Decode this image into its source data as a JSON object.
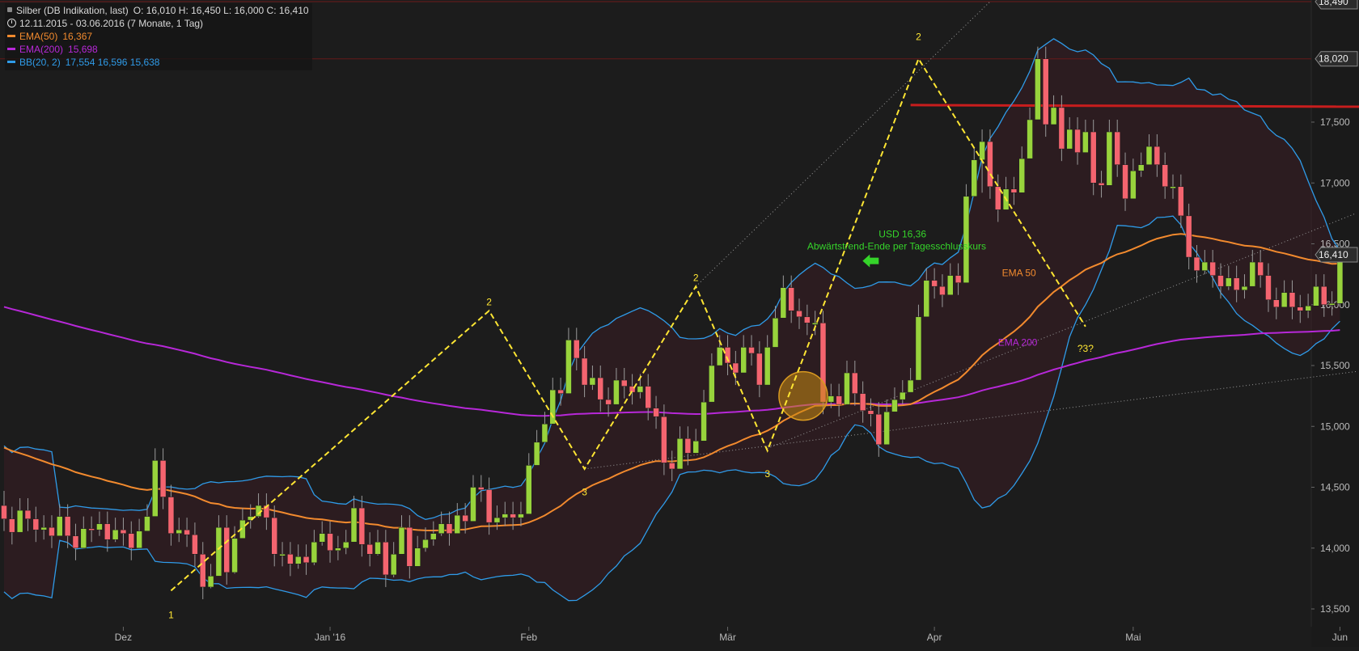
{
  "legend": {
    "title": "Silber (DB Indikation, last)",
    "ohlc": "O: 16,010  H: 16,450  L: 16,000  C: 16,410",
    "range": "12.11.2015 - 03.06.2016 (7 Monate, 1 Tag)",
    "indicators": [
      {
        "label": "EMA(50)",
        "values": "16,367",
        "color": "#f28a2e"
      },
      {
        "label": "EMA(200)",
        "values": "15,698",
        "color": "#b728d8"
      },
      {
        "label": "BB(20, 2)",
        "values": "17,554  16,596  15,638",
        "color": "#2f9be8"
      }
    ]
  },
  "colors": {
    "background": "#1c1c1c",
    "up": "#98d33c",
    "down": "#f4646f",
    "wick": "#9a9a9a",
    "ema50": "#f28a2e",
    "ema200": "#b728d8",
    "bb": "#2f9be8",
    "pattern": "#ffe633",
    "resistance": "#c81d1d",
    "annotation_green": "#35d42a",
    "axis_text": "#bbbbbb"
  },
  "chart_data": {
    "type": "candlestick",
    "instrument": "Silber (DB Indikation, last)",
    "ylim": [
      13.4,
      18.5
    ],
    "y_ticks": [
      {
        "v": 13.5,
        "label": "13,500"
      },
      {
        "v": 14.0,
        "label": "14,000"
      },
      {
        "v": 14.5,
        "label": "14,500"
      },
      {
        "v": 15.0,
        "label": "15,000"
      },
      {
        "v": 15.5,
        "label": "15,500"
      },
      {
        "v": 16.0,
        "label": "16,000"
      },
      {
        "v": 16.5,
        "label": "16,500"
      },
      {
        "v": 17.0,
        "label": "17,000"
      },
      {
        "v": 17.5,
        "label": "17,500"
      }
    ],
    "y_tags": [
      {
        "v": 18.49,
        "label": "18,490"
      },
      {
        "v": 18.02,
        "label": "18,020"
      },
      {
        "v": 16.41,
        "label": "16,410"
      }
    ],
    "x_ticks": [
      {
        "i": 15,
        "label": "Dez"
      },
      {
        "i": 41,
        "label": "Jan '16"
      },
      {
        "i": 66,
        "label": "Feb"
      },
      {
        "i": 91,
        "label": "Mär"
      },
      {
        "i": 117,
        "label": "Apr"
      },
      {
        "i": 142,
        "label": "Mai"
      },
      {
        "i": 168,
        "label": "Jun"
      }
    ],
    "candles": [
      [
        14.35,
        14.24,
        14.47,
        14.14
      ],
      [
        14.24,
        14.13,
        14.34,
        14.03
      ],
      [
        14.13,
        14.31,
        14.41,
        14.21
      ],
      [
        14.31,
        14.24,
        14.41,
        14.14
      ],
      [
        14.24,
        14.15,
        14.34,
        14.05
      ],
      [
        14.15,
        14.17,
        14.27,
        14.07
      ],
      [
        14.17,
        14.1,
        14.27,
        14.0
      ],
      [
        14.1,
        14.26,
        14.36,
        14.16
      ],
      [
        14.26,
        14.1,
        14.36,
        14.0
      ],
      [
        14.1,
        14.0,
        14.2,
        13.9
      ],
      [
        14.0,
        14.16,
        14.26,
        14.06
      ],
      [
        14.16,
        14.15,
        14.26,
        14.05
      ],
      [
        14.15,
        14.2,
        14.3,
        14.1
      ],
      [
        14.2,
        14.07,
        14.3,
        13.97
      ],
      [
        14.07,
        14.15,
        14.25,
        14.05
      ],
      [
        14.15,
        14.12,
        14.25,
        14.02
      ],
      [
        14.12,
        14.0,
        14.22,
        13.9
      ],
      [
        14.0,
        14.14,
        14.24,
        14.04
      ],
      [
        14.14,
        14.26,
        14.36,
        14.16
      ],
      [
        14.26,
        14.72,
        14.82,
        14.63
      ],
      [
        14.72,
        14.42,
        14.82,
        14.32
      ],
      [
        14.42,
        14.12,
        14.52,
        14.02
      ],
      [
        14.12,
        14.15,
        14.25,
        14.05
      ],
      [
        14.15,
        14.11,
        14.25,
        14.01
      ],
      [
        14.11,
        13.95,
        14.21,
        13.85
      ],
      [
        13.95,
        13.68,
        14.05,
        13.58
      ],
      [
        13.68,
        13.77,
        13.87,
        13.67
      ],
      [
        13.77,
        14.17,
        14.27,
        13.92
      ],
      [
        14.17,
        13.8,
        14.27,
        13.7
      ],
      [
        13.8,
        14.08,
        14.18,
        13.79
      ],
      [
        14.08,
        14.23,
        14.33,
        14.13
      ],
      [
        14.23,
        14.26,
        14.36,
        14.16
      ],
      [
        14.26,
        14.35,
        14.45,
        14.25
      ],
      [
        14.35,
        14.25,
        14.45,
        14.15
      ],
      [
        14.25,
        13.95,
        14.35,
        13.85
      ],
      [
        13.95,
        13.95,
        14.05,
        13.85
      ],
      [
        13.95,
        13.87,
        14.05,
        13.77
      ],
      [
        13.87,
        13.93,
        14.03,
        13.83
      ],
      [
        13.93,
        13.88,
        14.03,
        13.78
      ],
      [
        13.88,
        14.05,
        14.15,
        13.86
      ],
      [
        14.05,
        14.12,
        14.22,
        14.02
      ],
      [
        14.12,
        13.98,
        14.22,
        13.88
      ],
      [
        13.98,
        14.0,
        14.1,
        13.9
      ],
      [
        14.0,
        14.05,
        14.15,
        13.95
      ],
      [
        14.05,
        14.33,
        14.43,
        14.23
      ],
      [
        14.33,
        14.03,
        14.43,
        13.93
      ],
      [
        14.03,
        13.95,
        14.13,
        13.85
      ],
      [
        13.95,
        14.05,
        14.15,
        13.94
      ],
      [
        14.05,
        13.78,
        14.15,
        13.68
      ],
      [
        13.78,
        13.95,
        14.05,
        13.76
      ],
      [
        13.95,
        14.17,
        14.27,
        14.07
      ],
      [
        14.17,
        13.85,
        14.27,
        13.75
      ],
      [
        13.85,
        14.0,
        14.1,
        13.9
      ],
      [
        14.0,
        14.07,
        14.17,
        13.97
      ],
      [
        14.07,
        14.12,
        14.22,
        14.02
      ],
      [
        14.12,
        14.2,
        14.3,
        14.1
      ],
      [
        14.2,
        14.12,
        14.3,
        14.02
      ],
      [
        14.12,
        14.27,
        14.37,
        14.17
      ],
      [
        14.27,
        14.22,
        14.37,
        14.12
      ],
      [
        14.22,
        14.5,
        14.6,
        14.4
      ],
      [
        14.5,
        14.48,
        14.6,
        14.38
      ],
      [
        14.48,
        14.21,
        14.58,
        14.11
      ],
      [
        14.21,
        14.25,
        14.35,
        14.15
      ],
      [
        14.25,
        14.28,
        14.38,
        14.18
      ],
      [
        14.28,
        14.25,
        14.38,
        14.15
      ],
      [
        14.25,
        14.28,
        14.38,
        14.18
      ],
      [
        14.28,
        14.68,
        14.78,
        14.58
      ],
      [
        14.68,
        14.87,
        14.97,
        14.77
      ],
      [
        14.87,
        15.02,
        15.12,
        14.92
      ],
      [
        15.02,
        15.3,
        15.4,
        15.2
      ],
      [
        15.3,
        15.27,
        15.4,
        15.17
      ],
      [
        15.27,
        15.71,
        15.81,
        15.61
      ],
      [
        15.71,
        15.56,
        15.81,
        15.46
      ],
      [
        15.56,
        15.34,
        15.66,
        15.24
      ],
      [
        15.34,
        15.4,
        15.5,
        15.3
      ],
      [
        15.4,
        15.22,
        15.5,
        15.12
      ],
      [
        15.22,
        15.18,
        15.32,
        15.08
      ],
      [
        15.18,
        15.38,
        15.48,
        15.28
      ],
      [
        15.38,
        15.33,
        15.48,
        15.23
      ],
      [
        15.33,
        15.28,
        15.43,
        15.18
      ],
      [
        15.28,
        15.33,
        15.43,
        15.23
      ],
      [
        15.33,
        15.15,
        15.43,
        15.05
      ],
      [
        15.15,
        15.08,
        15.25,
        14.98
      ],
      [
        15.08,
        14.7,
        15.18,
        14.6
      ],
      [
        14.7,
        14.65,
        14.8,
        14.55
      ],
      [
        14.65,
        14.9,
        15.0,
        14.8
      ],
      [
        14.9,
        14.78,
        15.0,
        14.68
      ],
      [
        14.78,
        14.88,
        14.98,
        14.78
      ],
      [
        14.88,
        15.2,
        15.3,
        15.1
      ],
      [
        15.2,
        15.5,
        15.6,
        15.4
      ],
      [
        15.5,
        15.65,
        15.75,
        15.55
      ],
      [
        15.65,
        15.52,
        15.75,
        15.42
      ],
      [
        15.52,
        15.44,
        15.62,
        15.34
      ],
      [
        15.44,
        15.65,
        15.75,
        15.55
      ],
      [
        15.65,
        15.6,
        15.75,
        15.5
      ],
      [
        15.6,
        15.34,
        15.7,
        15.24
      ],
      [
        15.34,
        15.65,
        15.75,
        15.55
      ],
      [
        15.65,
        15.89,
        15.99,
        15.79
      ],
      [
        15.89,
        16.14,
        16.24,
        16.04
      ],
      [
        16.14,
        15.95,
        16.24,
        15.85
      ],
      [
        15.95,
        15.9,
        16.05,
        15.8
      ],
      [
        15.9,
        15.85,
        16.0,
        15.75
      ],
      [
        15.85,
        15.85,
        15.95,
        15.75
      ],
      [
        15.85,
        15.2,
        15.95,
        15.1
      ],
      [
        15.2,
        15.25,
        15.35,
        15.15
      ],
      [
        15.25,
        15.18,
        15.35,
        15.08
      ],
      [
        15.18,
        15.44,
        15.54,
        15.34
      ],
      [
        15.44,
        15.27,
        15.54,
        15.17
      ],
      [
        15.27,
        15.13,
        15.37,
        15.03
      ],
      [
        15.13,
        15.1,
        15.23,
        15.0
      ],
      [
        15.1,
        14.85,
        15.2,
        14.75
      ],
      [
        14.85,
        15.12,
        15.22,
        15.02
      ],
      [
        15.12,
        15.22,
        15.32,
        15.12
      ],
      [
        15.22,
        15.28,
        15.38,
        15.18
      ],
      [
        15.28,
        15.38,
        15.48,
        15.28
      ],
      [
        15.38,
        15.9,
        16.0,
        15.8
      ],
      [
        15.9,
        16.2,
        16.3,
        16.1
      ],
      [
        16.2,
        16.15,
        16.3,
        16.05
      ],
      [
        16.15,
        16.08,
        16.25,
        15.98
      ],
      [
        16.08,
        16.24,
        16.34,
        16.14
      ],
      [
        16.24,
        16.18,
        16.34,
        16.08
      ],
      [
        16.18,
        16.89,
        16.99,
        16.79
      ],
      [
        16.89,
        17.19,
        17.29,
        17.09
      ],
      [
        17.19,
        17.34,
        17.44,
        16.92
      ],
      [
        17.34,
        16.97,
        17.44,
        16.87
      ],
      [
        16.97,
        16.78,
        17.07,
        16.68
      ],
      [
        16.78,
        16.95,
        17.05,
        16.85
      ],
      [
        16.95,
        16.92,
        17.05,
        16.82
      ],
      [
        16.92,
        17.2,
        17.3,
        17.1
      ],
      [
        17.2,
        17.52,
        17.62,
        17.42
      ],
      [
        17.52,
        18.02,
        18.12,
        17.92
      ],
      [
        18.02,
        17.48,
        18.12,
        17.38
      ],
      [
        17.48,
        17.62,
        17.72,
        17.52
      ],
      [
        17.62,
        17.28,
        17.72,
        17.18
      ],
      [
        17.28,
        17.44,
        17.54,
        17.34
      ],
      [
        17.44,
        17.25,
        17.54,
        17.15
      ],
      [
        17.25,
        17.42,
        17.52,
        17.32
      ],
      [
        17.42,
        17.0,
        17.52,
        16.9
      ],
      [
        17.0,
        16.98,
        17.1,
        16.88
      ],
      [
        16.98,
        17.42,
        17.52,
        17.32
      ],
      [
        17.42,
        17.15,
        17.52,
        17.05
      ],
      [
        17.15,
        16.87,
        17.25,
        16.77
      ],
      [
        16.87,
        17.1,
        17.2,
        17.0
      ],
      [
        17.1,
        17.15,
        17.25,
        17.05
      ],
      [
        17.15,
        17.3,
        17.4,
        17.2
      ],
      [
        17.3,
        17.15,
        17.4,
        17.05
      ],
      [
        17.15,
        16.97,
        17.25,
        16.87
      ],
      [
        16.97,
        16.97,
        17.07,
        16.87
      ],
      [
        16.97,
        16.73,
        17.07,
        16.63
      ],
      [
        16.73,
        16.39,
        16.83,
        16.29
      ],
      [
        16.39,
        16.28,
        16.49,
        16.18
      ],
      [
        16.28,
        16.35,
        16.45,
        16.25
      ],
      [
        16.35,
        16.24,
        16.45,
        16.14
      ],
      [
        16.24,
        16.15,
        16.34,
        16.05
      ],
      [
        16.15,
        16.22,
        16.32,
        16.12
      ],
      [
        16.22,
        16.12,
        16.32,
        16.02
      ],
      [
        16.12,
        16.15,
        16.25,
        16.05
      ],
      [
        16.15,
        16.35,
        16.45,
        16.25
      ],
      [
        16.35,
        16.24,
        16.45,
        16.14
      ],
      [
        16.24,
        16.04,
        16.34,
        15.94
      ],
      [
        16.04,
        15.98,
        16.14,
        15.88
      ],
      [
        15.98,
        16.1,
        16.2,
        16.0
      ],
      [
        16.1,
        15.98,
        16.2,
        15.88
      ],
      [
        15.98,
        15.95,
        16.08,
        15.85
      ],
      [
        15.95,
        15.99,
        16.09,
        15.89
      ],
      [
        15.99,
        16.15,
        16.25,
        16.05
      ],
      [
        16.15,
        16.0,
        16.25,
        15.9
      ],
      [
        16.0,
        16.01,
        16.11,
        15.91
      ],
      [
        16.01,
        16.41,
        16.45,
        16.0
      ]
    ],
    "pattern": {
      "points": [
        [
          21,
          13.65
        ],
        [
          61,
          15.95
        ],
        [
          73,
          14.65
        ],
        [
          87,
          16.15
        ],
        [
          96,
          14.8
        ],
        [
          115,
          18.02
        ],
        [
          136,
          15.82
        ]
      ],
      "labels": [
        {
          "i": 21,
          "v": 13.45,
          "text": "1"
        },
        {
          "i": 61,
          "v": 16.02,
          "text": "2"
        },
        {
          "i": 73,
          "v": 14.46,
          "text": "3"
        },
        {
          "i": 87,
          "v": 16.22,
          "text": "2"
        },
        {
          "i": 96,
          "v": 14.61,
          "text": "3"
        },
        {
          "i": 115,
          "v": 18.2,
          "text": "2"
        },
        {
          "i": 136,
          "v": 15.64,
          "text": "?3?"
        }
      ]
    },
    "annotations": [
      {
        "text": "USD 16,36",
        "i": 110,
        "v": 16.58,
        "color": "#35d42a",
        "anchor": "start"
      },
      {
        "text": "Abwärtstrend-Ende per Tagesschlusskurs",
        "i": 101,
        "v": 16.48,
        "color": "#35d42a",
        "anchor": "start"
      },
      {
        "text": "EMA 50",
        "i": 125.5,
        "v": 16.26,
        "color": "#f28a2e",
        "anchor": "start"
      },
      {
        "text": "EMA 200",
        "i": 125,
        "v": 15.69,
        "color": "#b728d8",
        "anchor": "start"
      }
    ],
    "resistance": {
      "v": 17.64,
      "from_i": 114
    },
    "arrow": {
      "i": 110,
      "v": 16.36
    },
    "circle": {
      "i": 100.5,
      "v": 15.25
    },
    "trendlines": [
      [
        [
          96,
          14.82
        ],
        [
          170,
          16.75
        ]
      ],
      [
        [
          73,
          14.65
        ],
        [
          170,
          15.45
        ]
      ],
      [
        [
          87,
          16.15
        ],
        [
          124,
          18.49
        ]
      ]
    ]
  }
}
